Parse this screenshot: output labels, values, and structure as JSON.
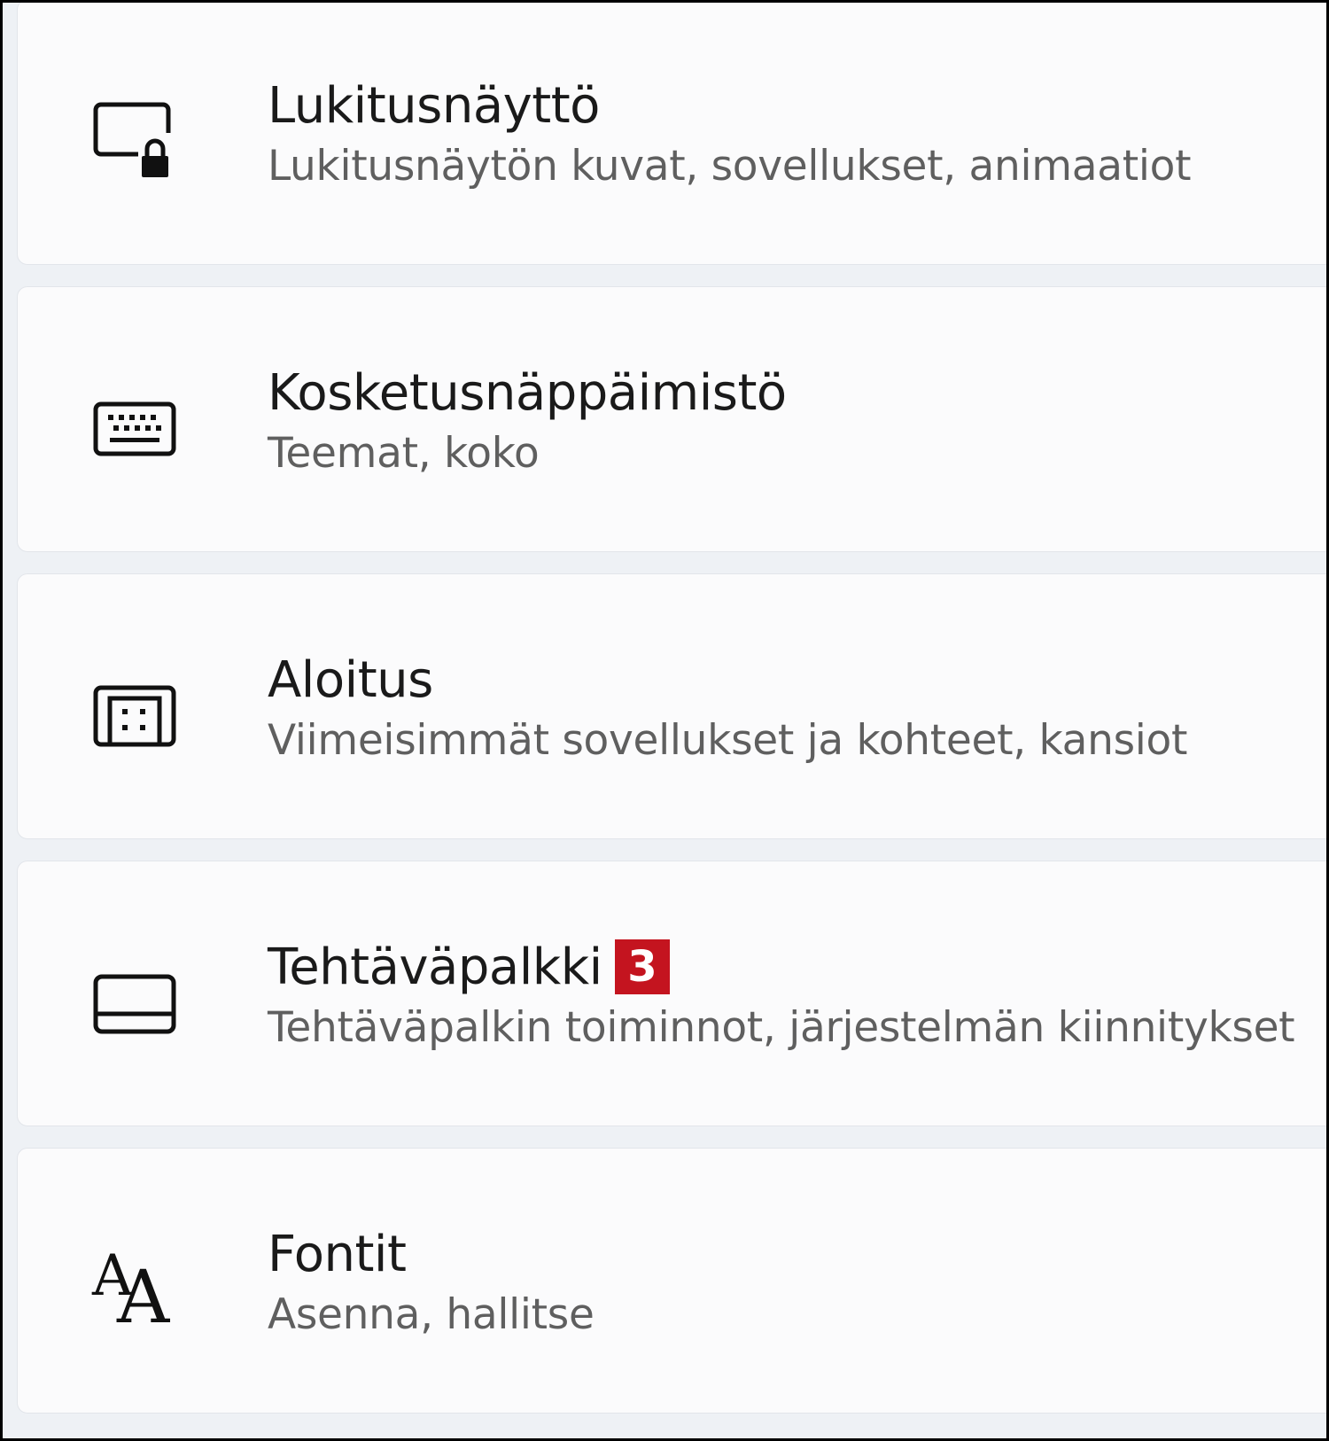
{
  "settings_list": {
    "items": [
      {
        "title": "Lukitusnäyttö",
        "subtitle": "Lukitusnäytön kuvat, sovellukset, animaatiot",
        "icon": "lock-screen-icon"
      },
      {
        "title": "Kosketusnäppäimistö",
        "subtitle": "Teemat, koko",
        "icon": "keyboard-icon"
      },
      {
        "title": "Aloitus",
        "subtitle": "Viimeisimmät sovellukset ja kohteet, kansiot",
        "icon": "start-menu-icon"
      },
      {
        "title": "Tehtäväpalkki",
        "badge": "3",
        "subtitle": "Tehtäväpalkin toiminnot, järjestelmän kiinnitykset",
        "icon": "taskbar-icon"
      },
      {
        "title": "Fontit",
        "subtitle": "Asenna, hallitse",
        "icon": "fonts-icon"
      }
    ]
  },
  "colors": {
    "background": "#eef1f5",
    "card": "#fbfbfc",
    "title_text": "#1a1a1a",
    "subtitle_text": "#5f5f5f",
    "badge": "#c4141f"
  }
}
